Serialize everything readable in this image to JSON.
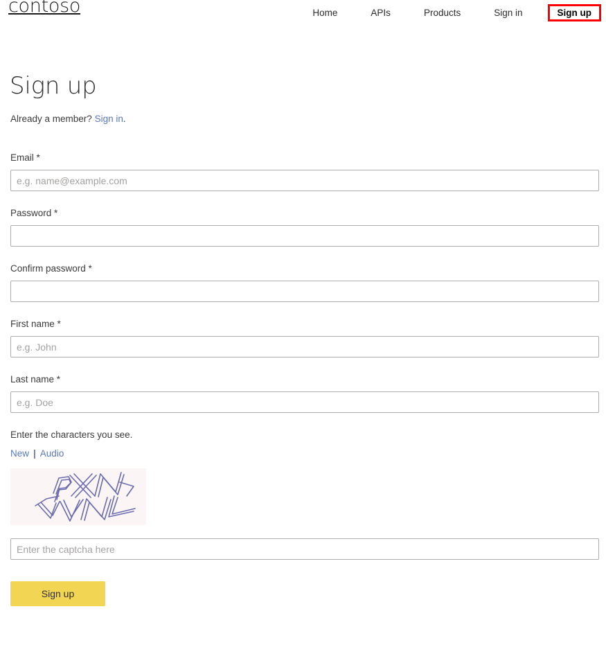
{
  "brand": {
    "logo_text": "contoso"
  },
  "nav": {
    "items": [
      {
        "label": "Home",
        "active": false
      },
      {
        "label": "APIs",
        "active": false
      },
      {
        "label": "Products",
        "active": false
      },
      {
        "label": "Sign in",
        "active": false
      },
      {
        "label": "Sign up",
        "active": true
      }
    ],
    "highlight_color": "#ff0000"
  },
  "page": {
    "title": "Sign up",
    "subtitle_prefix": "Already a member? ",
    "subtitle_link": "Sign in",
    "subtitle_suffix": "."
  },
  "form": {
    "fields": [
      {
        "label": "Email *",
        "placeholder": "e.g. name@example.com",
        "value": "",
        "type": "text"
      },
      {
        "label": "Password *",
        "placeholder": "",
        "value": "",
        "type": "password"
      },
      {
        "label": "Confirm password *",
        "placeholder": "",
        "value": "",
        "type": "password"
      },
      {
        "label": "First name *",
        "placeholder": "e.g. John",
        "value": "",
        "type": "text"
      },
      {
        "label": "Last name *",
        "placeholder": "e.g. Doe",
        "value": "",
        "type": "text"
      }
    ]
  },
  "captcha": {
    "prompt": "Enter the characters you see.",
    "new_label": "New",
    "separator": "|",
    "audio_label": "Audio",
    "image_text": "PXNYVNL",
    "image_background": "#fbf6f5",
    "image_stroke": "#6b6bb0",
    "input_placeholder": "Enter the captcha here",
    "input_value": ""
  },
  "submit": {
    "label": "Sign up",
    "color": "#f2d653"
  },
  "colors": {
    "link": "#5a77bd",
    "text": "#3b3b3b",
    "border": "#adadad"
  }
}
